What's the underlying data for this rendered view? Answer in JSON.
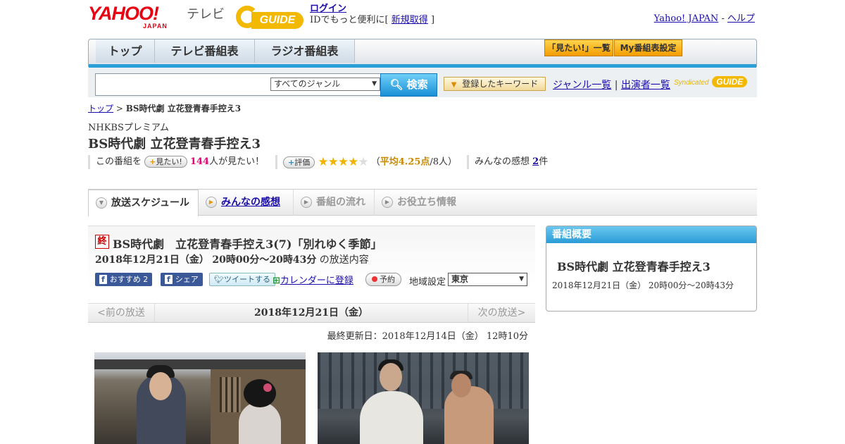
{
  "header": {
    "logo_text": "YAHOO!",
    "logo_sub": "JAPAN",
    "service": "テレビ",
    "gguide_logo": "GUIDE",
    "login_label": "ログイン",
    "login_sub_prefix": "IDでもっと便利に[",
    "signup_label": "新規取得",
    "login_sub_suffix": "]",
    "yahoo_japan_link": "Yahoo! JAPAN",
    "sep": "-",
    "help_link": "ヘルプ"
  },
  "tabs": [
    {
      "label": "トップ"
    },
    {
      "label": "テレビ番組表"
    },
    {
      "label": "ラジオ番組表"
    }
  ],
  "tab_buttons": [
    {
      "label": "「見たい!」一覧"
    },
    {
      "label": "My番組表設定"
    }
  ],
  "search": {
    "genre_selected": "すべてのジャンル",
    "button_label": "検索",
    "keyword_button": "登録したキーワード",
    "genre_list_link": "ジャンル一覧",
    "divider": "|",
    "cast_list_link": "出演者一覧",
    "syndicated": "Syndicated",
    "syndicated_logo": "GUIDE"
  },
  "breadcrumb": {
    "top": "トップ",
    "sep": ">",
    "current": "BS時代劇 立花登青春手控え3"
  },
  "program": {
    "station": "NHKBSプレミアム",
    "title": "BS時代劇 立花登青春手控え3",
    "want_prefix": "この番組を",
    "want_button": "見たい!",
    "want_count": "144",
    "want_suffix": "人が見たい！",
    "rating_button": "評価",
    "rating_value": 4.25,
    "rating_text_prefix": "（",
    "rating_avg": "平均4.25点",
    "rating_people": "/8人）",
    "impressions_label": "みんなの感想",
    "impressions_count": "2",
    "impressions_suffix": "件"
  },
  "subnav": [
    {
      "label": "放送スケジュール"
    },
    {
      "label": "みんなの感想"
    },
    {
      "label": "番組の流れ"
    },
    {
      "label": "お役立ち情報"
    }
  ],
  "episode": {
    "end_badge": "終",
    "title": "BS時代劇　立花登青春手控え3(7)「別れゆく季節」",
    "date": "2018年12月21日（金）",
    "time": "20時00分～20時43分",
    "date_suffix": "の放送内容",
    "fb_recommend": "おすすめ 2",
    "fb_share": "シェア",
    "tweet": "ツイートする",
    "calendar": "カレンダーに登録",
    "reserve": "予約",
    "region_label": "地域設定",
    "region_value": "東京"
  },
  "pager": {
    "prev": "<前の放送",
    "date": "2018年12月21日（金）",
    "next": "次の放送>"
  },
  "updated": "最終更新日：2018年12月14日（金） 12時10分",
  "sidebar": {
    "heading": "番組概要",
    "title": "BS時代劇 立花登青春手控え3",
    "date": "2018年12月21日（金） 20時00分～20時43分"
  }
}
